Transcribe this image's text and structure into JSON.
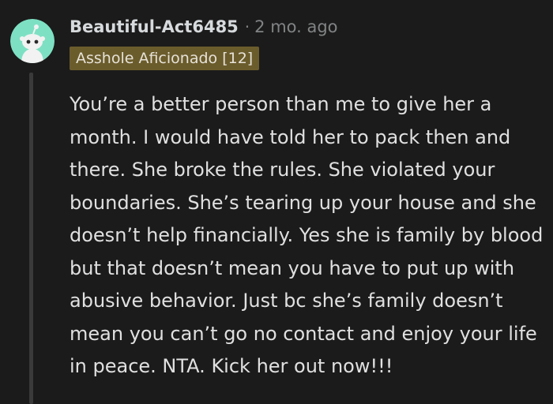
{
  "comment": {
    "username": "Beautiful-Act6485",
    "separator": "·",
    "timestamp": "2 mo. ago",
    "flair": "Asshole Aficionado [12]",
    "body": "You’re a better person than me to give her a month. I would have told her to pack then and there. She broke the rules. She violated your boundaries. She’s tearing up your house and she doesn’t help financially. Yes she is family by blood but that doesn’t mean you have to put up with abusive behavior. Just bc she’s family doesn’t mean you can’t go no contact and enjoy your life in peace. NTA. Kick her out now!!!"
  },
  "avatar": {
    "icon": "snoo-avatar-icon",
    "background_color": "#7ee0c3"
  },
  "colors": {
    "background": "#1b1b1b",
    "flair_background": "#6b5c2c",
    "text": "#e0e0e0",
    "muted": "#818384"
  }
}
